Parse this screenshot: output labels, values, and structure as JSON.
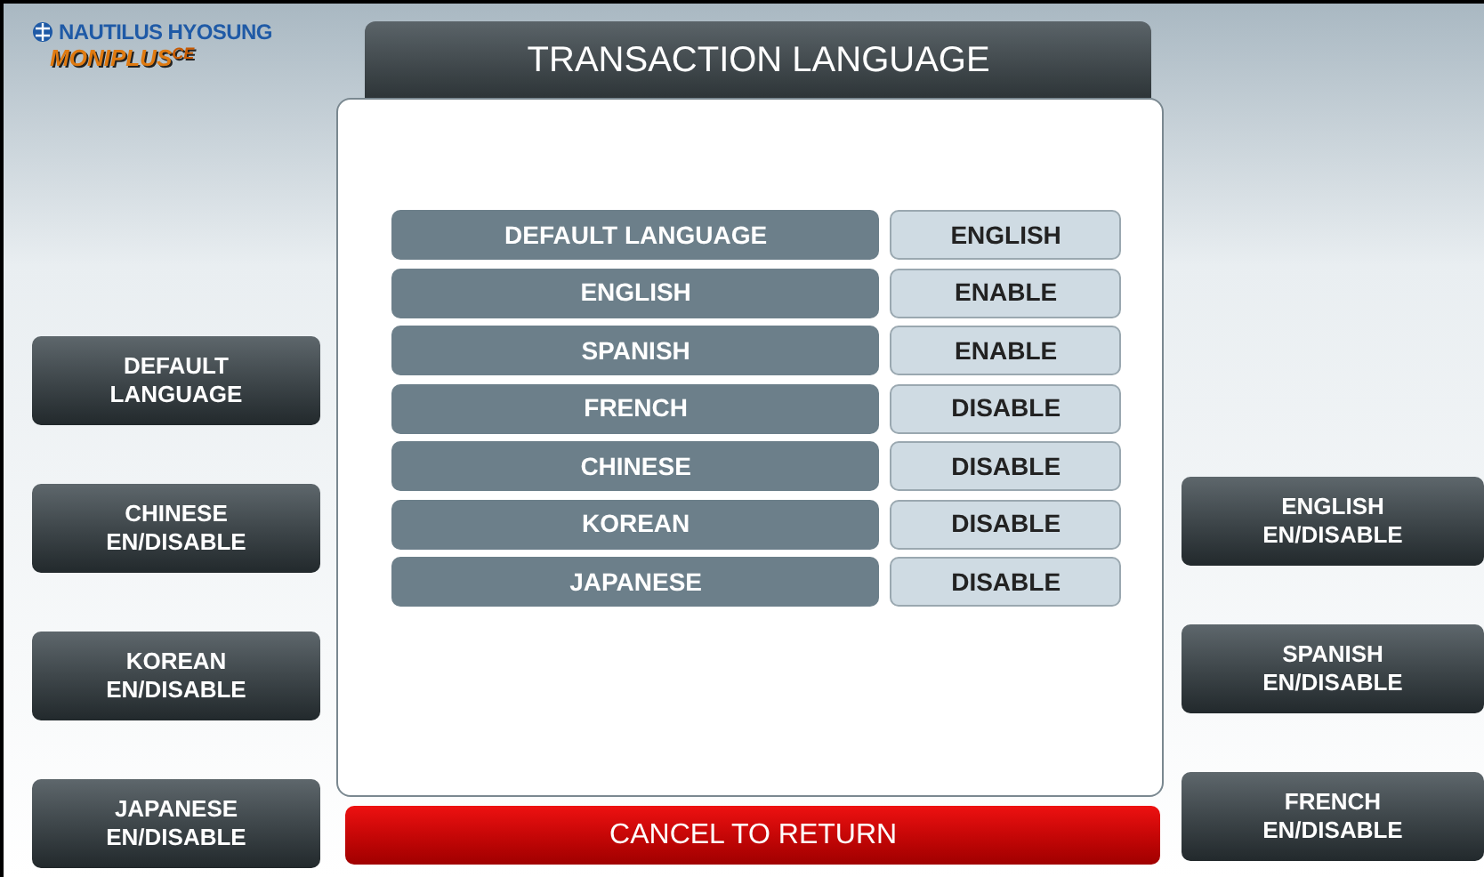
{
  "brand": {
    "company": "NAUTILUS HYOSUNG",
    "product": "MONIPLUS",
    "product_suffix": "CE"
  },
  "title": "TRANSACTION LANGUAGE",
  "rows": [
    {
      "name": "DEFAULT LANGUAGE",
      "value": "ENGLISH"
    },
    {
      "name": "ENGLISH",
      "value": "ENABLE"
    },
    {
      "name": "SPANISH",
      "value": "ENABLE"
    },
    {
      "name": "FRENCH",
      "value": "DISABLE"
    },
    {
      "name": "CHINESE",
      "value": "DISABLE"
    },
    {
      "name": "KOREAN",
      "value": "DISABLE"
    },
    {
      "name": "JAPANESE",
      "value": "DISABLE"
    }
  ],
  "left_keys": [
    {
      "lines": [
        "DEFAULT",
        "LANGUAGE"
      ]
    },
    {
      "lines": [
        "CHINESE",
        "EN/DISABLE"
      ]
    },
    {
      "lines": [
        "KOREAN",
        "EN/DISABLE"
      ]
    },
    {
      "lines": [
        "JAPANESE",
        "EN/DISABLE"
      ]
    }
  ],
  "right_keys": [
    {
      "lines": [
        "ENGLISH",
        "EN/DISABLE"
      ]
    },
    {
      "lines": [
        "SPANISH",
        "EN/DISABLE"
      ]
    },
    {
      "lines": [
        "FRENCH",
        "EN/DISABLE"
      ]
    }
  ],
  "cancel_button": "CANCEL TO RETURN"
}
